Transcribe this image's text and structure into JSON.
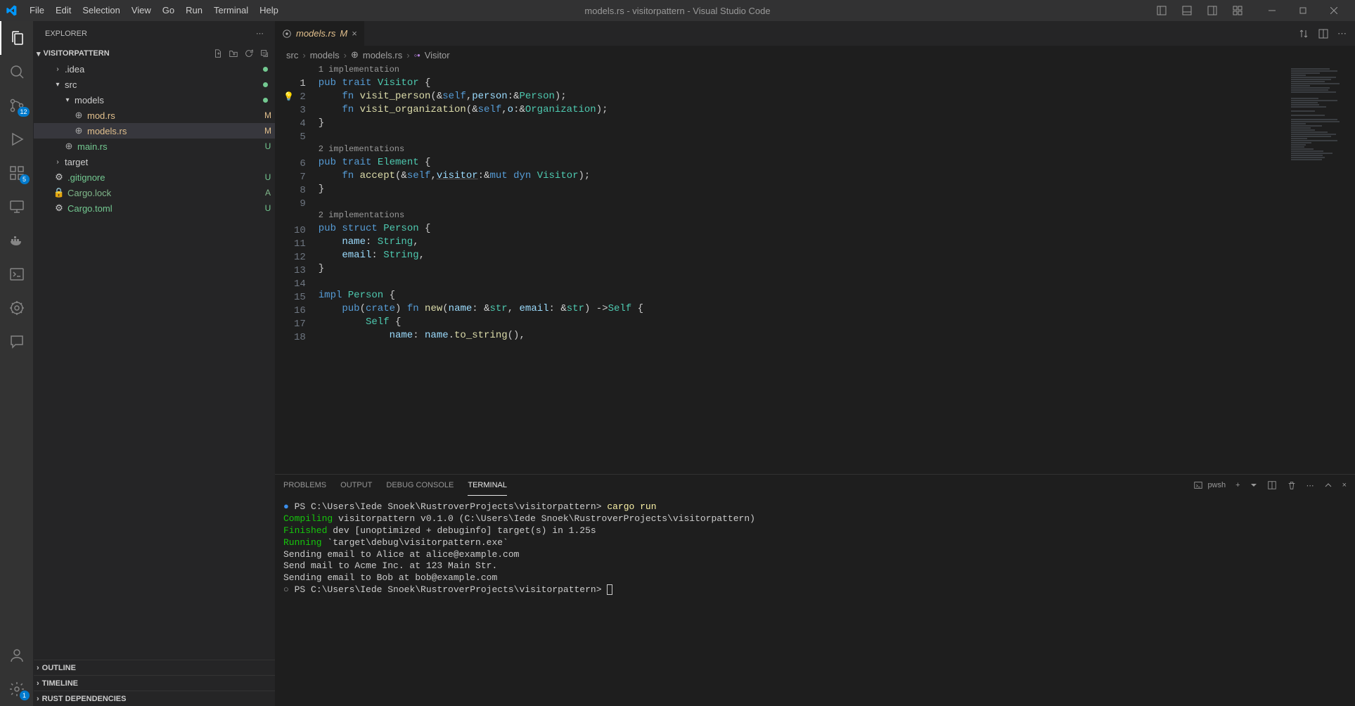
{
  "menu": [
    "File",
    "Edit",
    "Selection",
    "View",
    "Go",
    "Run",
    "Terminal",
    "Help"
  ],
  "title": "models.rs - visitorpattern - Visual Studio Code",
  "activity": {
    "source_control_badge": "12",
    "extensions_badge": "5",
    "settings_badge": "1"
  },
  "sidebar": {
    "title": "EXPLORER",
    "project": "VISITORPATTERN",
    "tree": [
      {
        "label": ".idea",
        "type": "folder",
        "status": "dot",
        "indent": 1
      },
      {
        "label": "src",
        "type": "folder-open",
        "status": "dot",
        "indent": 1
      },
      {
        "label": "models",
        "type": "folder-open",
        "status": "dot",
        "indent": 2
      },
      {
        "label": "mod.rs",
        "type": "file-rust",
        "status": "M",
        "indent": 3
      },
      {
        "label": "models.rs",
        "type": "file-rust",
        "status": "M",
        "indent": 3,
        "selected": true
      },
      {
        "label": "main.rs",
        "type": "file-rust",
        "status": "U",
        "indent": 2
      },
      {
        "label": "target",
        "type": "folder",
        "status": "",
        "indent": 1
      },
      {
        "label": ".gitignore",
        "type": "file-gear",
        "status": "U",
        "indent": 1
      },
      {
        "label": "Cargo.lock",
        "type": "file-lock",
        "status": "A",
        "indent": 1
      },
      {
        "label": "Cargo.toml",
        "type": "file-gear",
        "status": "U",
        "indent": 1
      }
    ],
    "sections": [
      "OUTLINE",
      "TIMELINE",
      "RUST DEPENDENCIES"
    ]
  },
  "tabs": {
    "open": [
      {
        "label": "models.rs",
        "status": "M"
      }
    ]
  },
  "breadcrumbs": [
    "src",
    "models",
    "models.rs",
    "Visitor"
  ],
  "codelens": {
    "visitor": "1 implementation",
    "element": "2 implementations",
    "person": "2 implementations"
  },
  "code_lines": [
    {
      "n": 1,
      "html": "<span class='tok-kw'>pub</span> <span class='tok-kw'>trait</span> <span class='tok-type'>Visitor</span> {"
    },
    {
      "n": 2,
      "html": "    <span class='tok-kw'>fn</span> <span class='tok-fn'>visit_person</span>(<span class='tok-punct'>&</span><span class='tok-self'>self</span>,<span class='tok-param'>person</span>:<span class='tok-punct'>&</span><span class='tok-type'>Person</span>);"
    },
    {
      "n": 3,
      "html": "    <span class='tok-kw'>fn</span> <span class='tok-fn'>visit_organization</span>(<span class='tok-punct'>&</span><span class='tok-self'>self</span>,<span class='tok-param'>o</span>:<span class='tok-punct'>&</span><span class='tok-type'>Organization</span>);"
    },
    {
      "n": 4,
      "html": "}"
    },
    {
      "n": 5,
      "html": ""
    },
    {
      "n": 6,
      "html": "<span class='tok-kw'>pub</span> <span class='tok-kw'>trait</span> <span class='tok-type'>Element</span> {"
    },
    {
      "n": 7,
      "html": "    <span class='tok-kw'>fn</span> <span class='tok-fn'>accept</span>(<span class='tok-punct'>&</span><span class='tok-self'>self</span>,<span class='tok-param underline'>visitor</span>:<span class='tok-punct'>&</span><span class='tok-kw'>mut</span> <span class='tok-kw'>dyn</span> <span class='tok-type'>Visitor</span>);"
    },
    {
      "n": 8,
      "html": "}"
    },
    {
      "n": 9,
      "html": ""
    },
    {
      "n": 10,
      "html": "<span class='tok-kw'>pub</span> <span class='tok-kw'>struct</span> <span class='tok-type'>Person</span> {"
    },
    {
      "n": 11,
      "html": "    <span class='tok-prop'>name</span>: <span class='tok-type'>String</span>,"
    },
    {
      "n": 12,
      "html": "    <span class='tok-prop'>email</span>: <span class='tok-type'>String</span>,"
    },
    {
      "n": 13,
      "html": "}"
    },
    {
      "n": 14,
      "html": ""
    },
    {
      "n": 15,
      "html": "<span class='tok-kw'>impl</span> <span class='tok-type'>Person</span> {"
    },
    {
      "n": 16,
      "html": "    <span class='tok-kw'>pub</span>(<span class='tok-kw'>crate</span>) <span class='tok-kw'>fn</span> <span class='tok-fn'>new</span>(<span class='tok-param'>name</span>: <span class='tok-punct'>&</span><span class='tok-type'>str</span>, <span class='tok-param'>email</span>: <span class='tok-punct'>&</span><span class='tok-type'>str</span>) -&gt;<span class='tok-type'>Self</span> {"
    },
    {
      "n": 17,
      "html": "        <span class='tok-type'>Self</span> {"
    },
    {
      "n": 18,
      "html": "            <span class='tok-prop'>name</span>: <span class='tok-param'>name</span>.<span class='tok-fn'>to_string</span>(),"
    }
  ],
  "panel": {
    "tabs": [
      "PROBLEMS",
      "OUTPUT",
      "DEBUG CONSOLE",
      "TERMINAL"
    ],
    "active_tab": "TERMINAL",
    "shell": "pwsh"
  },
  "terminal": {
    "prompt1": "PS C:\\Users\\Iede Snoek\\RustroverProjects\\visitorpattern>",
    "cmd1": "cargo run",
    "compile": "Compiling",
    "compile_rest": " visitorpattern v0.1.0 (C:\\Users\\Iede Snoek\\RustroverProjects\\visitorpattern)",
    "finished": "Finished",
    "finished_rest": " dev [unoptimized + debuginfo] target(s) in 1.25s",
    "running": "Running",
    "running_rest": " `target\\debug\\visitorpattern.exe`",
    "out1": "Sending email to Alice at alice@example.com",
    "out2": "Send mail to Acme Inc. at 123 Main Str.",
    "out3": "Sending email to Bob at bob@example.com",
    "prompt2": "PS C:\\Users\\Iede Snoek\\RustroverProjects\\visitorpattern>"
  }
}
